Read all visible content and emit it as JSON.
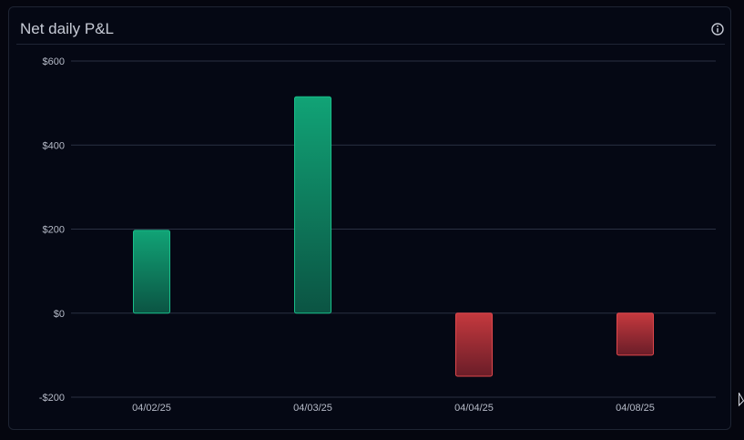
{
  "card": {
    "title": "Net daily P&L"
  },
  "icons": {
    "info": "info-icon"
  },
  "colors": {
    "positive": "#10a374",
    "positive_dark": "#0b5a46",
    "negative": "#d0393d",
    "negative_dark": "#6a1c25",
    "grid": "#2a3042",
    "text": "#b6bbc8"
  },
  "chart_data": {
    "type": "bar",
    "title": "Net daily P&L",
    "categories": [
      "04/02/25",
      "04/03/25",
      "04/04/25",
      "04/08/25"
    ],
    "values": [
      197,
      515,
      -150,
      -100
    ],
    "ylim": [
      -200,
      600
    ],
    "yticks": [
      600,
      400,
      200,
      0,
      -200
    ],
    "ytick_labels": [
      "$600",
      "$400",
      "$200",
      "$0",
      "-$200"
    ],
    "xlabel": "",
    "ylabel": "",
    "grid": true,
    "legend": "none"
  }
}
